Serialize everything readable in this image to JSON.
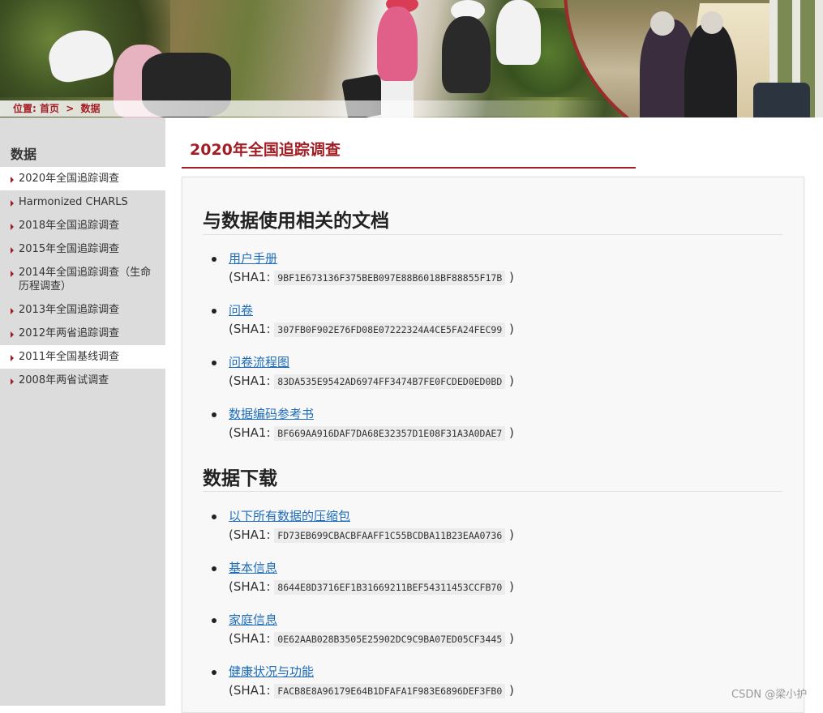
{
  "breadcrumb": {
    "prefix": "位置:",
    "home": "首页",
    "separator": ">",
    "current": "数据"
  },
  "sidebar": {
    "title": "数据",
    "items": [
      {
        "label": "2020年全国追踪调查",
        "active": true
      },
      {
        "label": "Harmonized CHARLS",
        "active": false
      },
      {
        "label": "2018年全国追踪调查",
        "active": false
      },
      {
        "label": "2015年全国追踪调查",
        "active": false
      },
      {
        "label": "2014年全国追踪调查（生命历程调查）",
        "active": false
      },
      {
        "label": "2013年全国追踪调查",
        "active": false
      },
      {
        "label": "2012年两省追踪调查",
        "active": false
      },
      {
        "label": "2011年全国基线调查",
        "active": true
      },
      {
        "label": "2008年两省试调查",
        "active": false
      }
    ]
  },
  "main": {
    "title": "2020年全国追踪调查",
    "sections": [
      {
        "heading": "与数据使用相关的文档",
        "files": [
          {
            "name": "用户手册",
            "sha_prefix": "(SHA1:",
            "sha": "9BF1E673136F375BEB097E88B6018BF88855F17B",
            "sha_suffix": ")"
          },
          {
            "name": "问卷",
            "sha_prefix": "(SHA1:",
            "sha": "307FB0F902E76FD08E07222324A4CE5FA24FEC99",
            "sha_suffix": ")"
          },
          {
            "name": "问卷流程图",
            "sha_prefix": "(SHA1:",
            "sha": "83DA535E9542AD6974FF3474B7FE0FCDED0ED0BD",
            "sha_suffix": ")"
          },
          {
            "name": "数据编码参考书",
            "sha_prefix": "(SHA1:",
            "sha": "BF669AA916DAF7DA68E32357D1E08F31A3A0DAE7",
            "sha_suffix": ")"
          }
        ]
      },
      {
        "heading": "数据下载",
        "files": [
          {
            "name": "以下所有数据的压缩包",
            "sha_prefix": "(SHA1:",
            "sha": "FD73EB699CBACBFAAFF1C55BCDBA11B23EAA0736",
            "sha_suffix": ")"
          },
          {
            "name": "基本信息",
            "sha_prefix": "(SHA1:",
            "sha": "8644E8D3716EF1B31669211BEF54311453CCFB70",
            "sha_suffix": ")"
          },
          {
            "name": "家庭信息",
            "sha_prefix": "(SHA1:",
            "sha": "0E62AAB028B3505E25902DC9C9BA07ED05CF3445",
            "sha_suffix": ")"
          },
          {
            "name": "健康状况与功能",
            "sha_prefix": "(SHA1:",
            "sha": "FACB8E8A96179E64B1DFAFA1F983E6896DEF3FB0",
            "sha_suffix": ")"
          }
        ]
      }
    ]
  },
  "watermark": "CSDN @梁小护",
  "colors": {
    "accent": "#a31d24",
    "link": "#1f6dba",
    "sidebar_bg": "#dcdcdc"
  }
}
